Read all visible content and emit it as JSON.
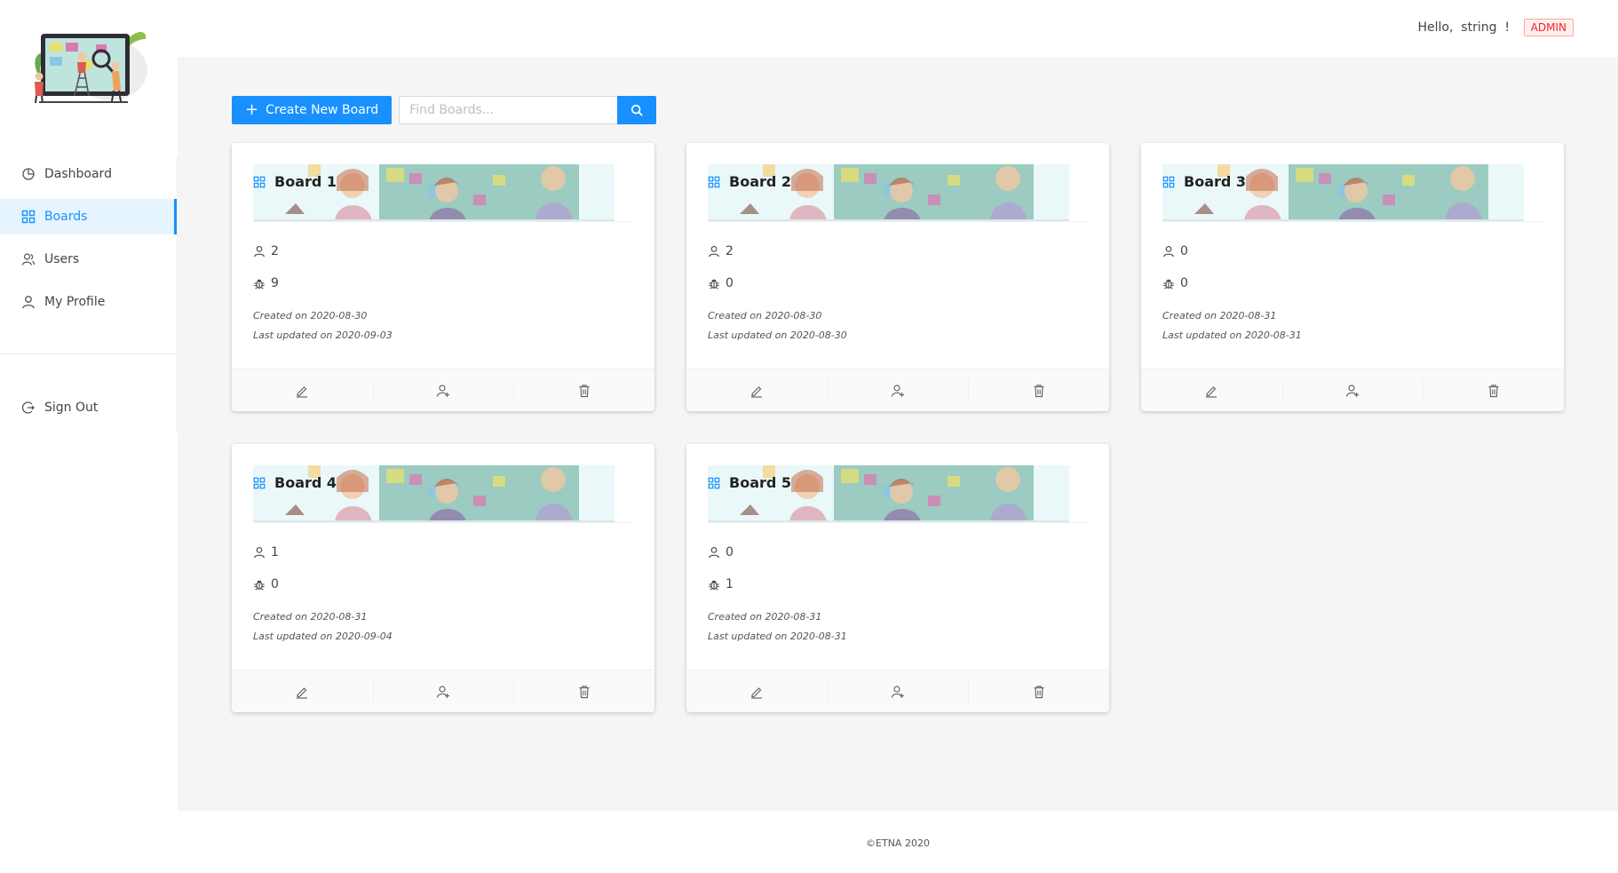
{
  "header": {
    "greeting": "Hello,  string  !",
    "role_tag": "ADMIN"
  },
  "sidebar": {
    "items": [
      {
        "label": "Dashboard",
        "icon": "pie-chart-icon",
        "active": false
      },
      {
        "label": "Boards",
        "icon": "appstore-icon",
        "active": true
      },
      {
        "label": "Users",
        "icon": "team-icon",
        "active": false
      },
      {
        "label": "My Profile",
        "icon": "user-icon",
        "active": false
      }
    ],
    "signout_label": "Sign Out"
  },
  "toolbar": {
    "create_label": "Create New Board",
    "search_placeholder": "Find Boards..."
  },
  "boards": [
    {
      "title": "Board 1",
      "members": "2",
      "bugs": "9",
      "created": "Created on 2020-08-30",
      "updated": "Last updated on 2020-09-03"
    },
    {
      "title": "Board 2",
      "members": "2",
      "bugs": "0",
      "created": "Created on 2020-08-30",
      "updated": "Last updated on 2020-08-30"
    },
    {
      "title": "Board 3",
      "members": "0",
      "bugs": "0",
      "created": "Created on 2020-08-31",
      "updated": "Last updated on 2020-08-31"
    },
    {
      "title": "Board 4",
      "members": "1",
      "bugs": "0",
      "created": "Created on 2020-08-31",
      "updated": "Last updated on 2020-09-04"
    },
    {
      "title": "Board 5",
      "members": "0",
      "bugs": "1",
      "created": "Created on 2020-08-31",
      "updated": "Last updated on 2020-08-31"
    }
  ],
  "footer": {
    "copyright": "©ETNA 2020"
  },
  "colors": {
    "primary": "#1890ff",
    "danger": "#f5222d",
    "content_bg": "#f5f5f5"
  }
}
